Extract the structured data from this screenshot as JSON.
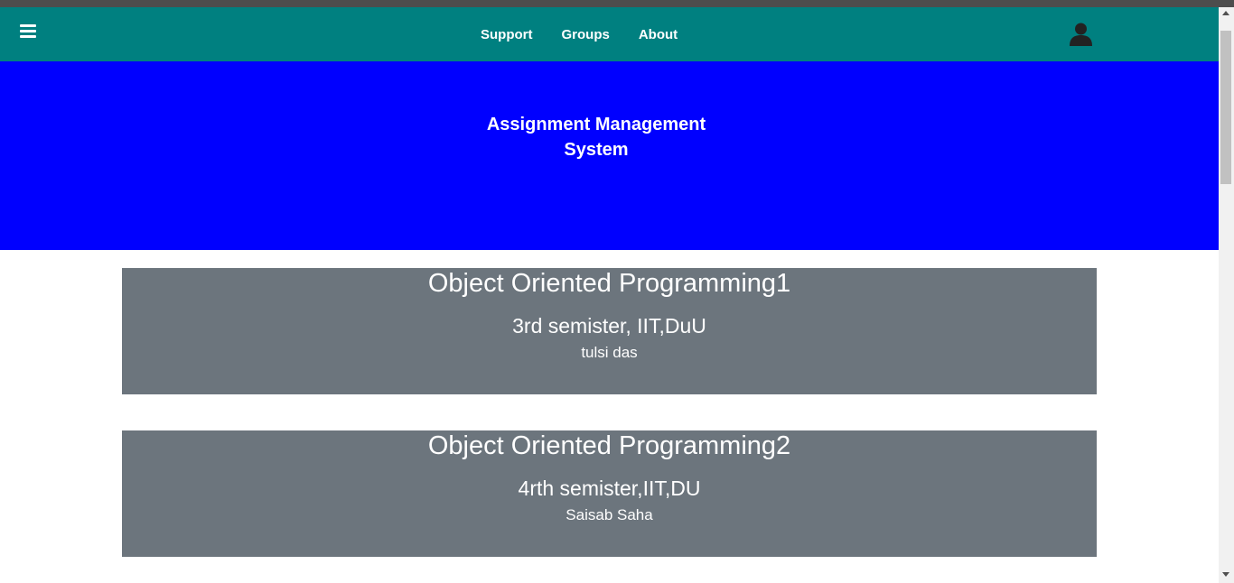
{
  "nav": {
    "menu_icon": "hamburger-icon",
    "links": [
      {
        "label": "Support"
      },
      {
        "label": "Groups"
      },
      {
        "label": "About"
      }
    ],
    "user_icon": "user-icon"
  },
  "hero": {
    "title": "Assignment Management System"
  },
  "courses": [
    {
      "title": "Object Oriented Programming1",
      "semester": "3rd semister, IIT,DuU",
      "teacher": "tulsi das"
    },
    {
      "title": "Object Oriented Programming2",
      "semester": "4rth semister,IIT,DU",
      "teacher": "Saisab Saha"
    }
  ],
  "colors": {
    "navbar": "#008080",
    "hero": "#0000ff",
    "card": "#6c757d"
  }
}
